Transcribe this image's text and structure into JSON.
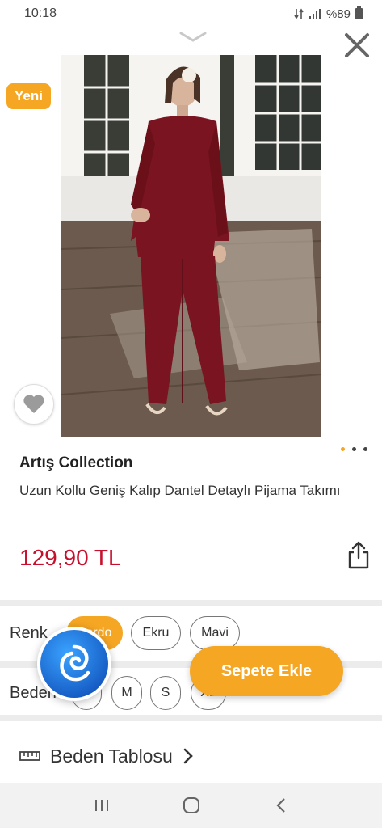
{
  "status_bar": {
    "time": "10:18",
    "battery": "%89",
    "icons": [
      "data-arrows-icon",
      "signal-icon",
      "battery-icon"
    ]
  },
  "product": {
    "badge": "Yeni",
    "brand": "Artış Collection",
    "title": "Uzun Kollu Geniş Kalıp Dantel Detaylı Pijama Takımı",
    "price": "129,90 TL",
    "image_pages": 3,
    "image_current_page": 1
  },
  "color": {
    "label": "Renk",
    "options": [
      "Bordo",
      "Ekru",
      "Mavi"
    ],
    "selected": "Bordo"
  },
  "size": {
    "label": "Beden",
    "options": [
      "S",
      "M",
      "S",
      "XL"
    ]
  },
  "actions": {
    "add_to_cart": "Sepete Ekle",
    "size_table": "Beden Tablosu"
  },
  "colors": {
    "accent": "#f5a623",
    "price": "#c8102e",
    "product": "#7a1420"
  }
}
